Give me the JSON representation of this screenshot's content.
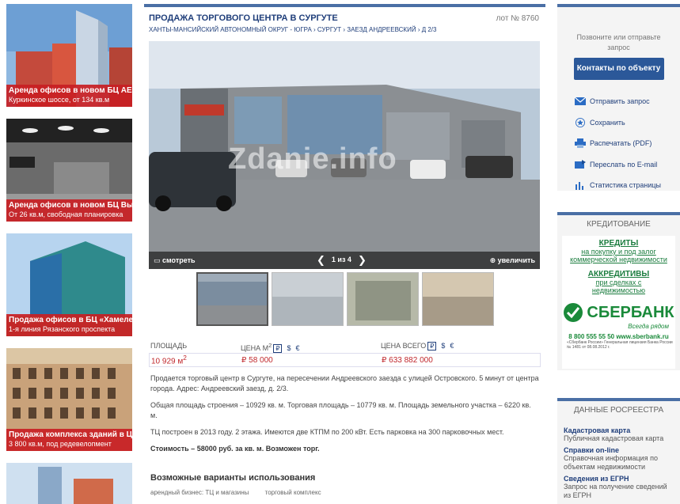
{
  "banners": [
    {
      "title": "Аренда офисов в новом БЦ AERO City",
      "subtitle": "Куркинское шоссе, от 134 кв.м"
    },
    {
      "title": "Аренда офисов в новом БЦ Высота",
      "subtitle": "От 26 кв.м, свободная планировка"
    },
    {
      "title": "Продажа офисов в БЦ «Хамелеон»",
      "subtitle": "1-я линия Рязанского проспекта"
    },
    {
      "title": "Продажа комплекса зданий в ЦАО",
      "subtitle": "3 800 кв.м, под редевелопмент"
    }
  ],
  "listing": {
    "title": "ПРОДАЖА ТОРГОВОГО ЦЕНТРА В СУРГУТЕ",
    "lot": "лот № 8760",
    "breadcrumb": "ХАНТЫ-МАНСИЙСКИЙ АВТОНОМНЫЙ ОКРУГ - ЮГРА › СУРГУТ › ЗАЕЗД АНДРЕЕВСКИЙ › Д 2/3",
    "photo_bar": {
      "view": "смотреть",
      "counter": "1 из 4",
      "zoom": "увеличить"
    },
    "watermark": "Zdanie.info",
    "prices": {
      "area_label": "ПЛОЩАДЬ",
      "price_m2_label": "ЦЕНА М",
      "price_total_label": "ЦЕНА ВСЕГО",
      "cur_rub": "₽",
      "cur_usd": "$",
      "cur_eur": "€",
      "area_value": "10 929 м",
      "area_sup": "2",
      "price_m2_value": "₽ 58 000",
      "price_total_value": "₽ 633 882 000"
    },
    "description": [
      "Продается торговый центр в Сургуте, на пересечении Андреевского заезда с улицей Островского. 5 минут от центра города. Адрес: Андреевский заезд, д. 2/3.",
      "Общая площадь строения – 10929 кв. м. Торговая площадь – 10779 кв. м. Площадь земельного участка – 6220 кв. м.",
      "ТЦ построен в 2013 году. 2 этажа. Имеются две КТПМ по 200 кВт. Есть парковка на 300 парковочных мест."
    ],
    "cost_note": "Стоимость – 58000 руб. за кв. м. Возможен торг.",
    "usage_title": "Возможные варианты использования",
    "usage_items": [
      "арендный бизнес: ТЦ и магазины",
      "торговый комплекс"
    ]
  },
  "sidebar": {
    "request_text": "Позвоните или отправьте запрос",
    "contact_button": "Контакты по объекту",
    "actions": [
      "Отправить запрос",
      "Сохранить",
      "Распечатать (PDF)",
      "Переслать по E-mail",
      "Статистика страницы"
    ],
    "credit_title": "КРЕДИТОВАНИЕ",
    "ad": {
      "line1": "КРЕДИТЫ",
      "line2": "на покупку и под залог",
      "line3": "коммерческой недвижимости",
      "line4": "АККРЕДИТИВЫ",
      "line5": "при сделках с",
      "line6": "недвижимостью",
      "brand": "СБЕРБАНК",
      "slogan": "Всегда рядом",
      "phone": "8 800 555 55 50  www.sberbank.ru",
      "legal": "«Сбербанк России» Генеральная лицензия Банка России № 1481 от 08.08.2012 г."
    },
    "ros_title": "ДАННЫЕ РОСРЕЕСТРА",
    "ros_items": [
      {
        "link": "Кадастровая карта",
        "desc": "Публичная кадастровая карта"
      },
      {
        "link": "Справки on-line",
        "desc": "Справочная информация по объектам недвижимости"
      },
      {
        "link": "Сведения из ЕГРН",
        "desc": "Запрос на получение сведений из ЕГРН"
      }
    ]
  }
}
